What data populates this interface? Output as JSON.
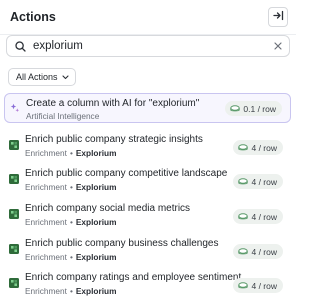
{
  "header": {
    "title": "Actions",
    "collapse_icon": "collapse-panel-icon"
  },
  "search": {
    "value": "explorium",
    "placeholder": ""
  },
  "filter": {
    "label": "All Actions"
  },
  "ai_action": {
    "title": "Create a column with AI for \"explorium\"",
    "subtitle": "Artificial Intelligence",
    "price": "0.1 / row",
    "icon": "sparkle-icon",
    "accent": "#c9c5f0"
  },
  "actions": [
    {
      "title": "Enrich public company strategic insights",
      "category": "Enrichment",
      "provider": "Explorium",
      "price": "4 / row"
    },
    {
      "title": "Enrich public company competitive landscape",
      "category": "Enrichment",
      "provider": "Explorium",
      "price": "4 / row"
    },
    {
      "title": "Enrich company social media metrics",
      "category": "Enrichment",
      "provider": "Explorium",
      "price": "4 / row"
    },
    {
      "title": "Enrich public company business challenges",
      "category": "Enrichment",
      "provider": "Explorium",
      "price": "4 / row"
    },
    {
      "title": "Enrich company ratings and employee sentiment",
      "category": "Enrichment",
      "provider": "Explorium",
      "price": "4 / row"
    }
  ],
  "colors": {
    "provider_icon": "#2f6b3a",
    "coin": "#5a9a6a"
  }
}
